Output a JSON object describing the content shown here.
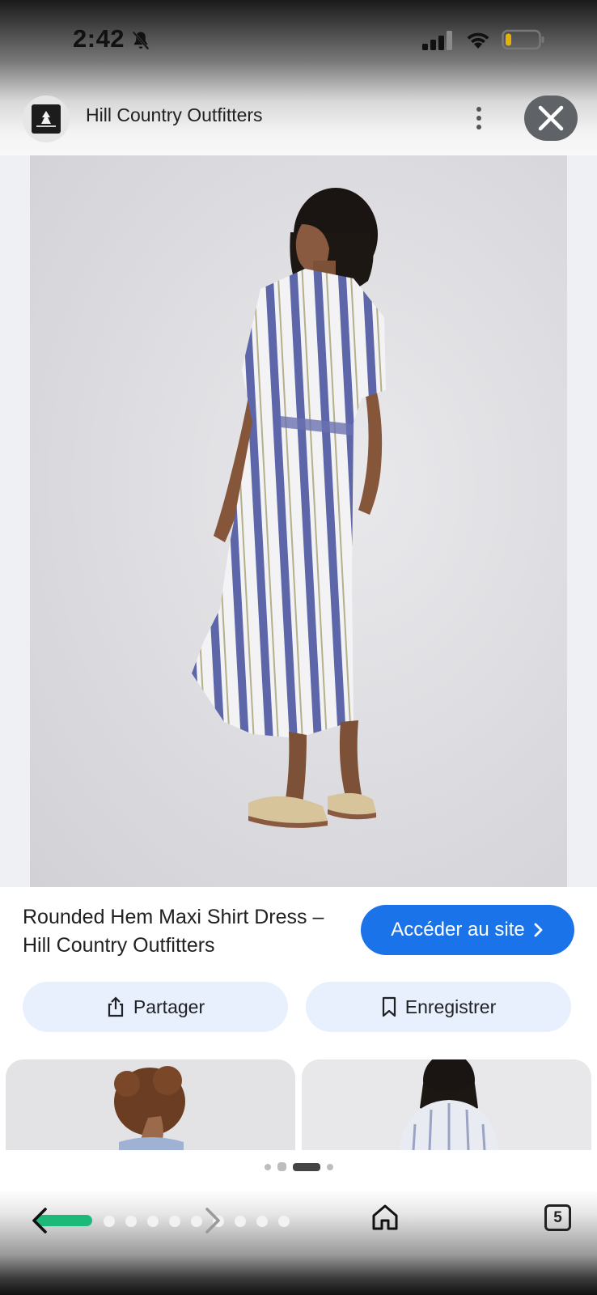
{
  "status_bar": {
    "time": "2:42",
    "icons": [
      "bell-off-icon",
      "signal-icon",
      "wifi-icon",
      "battery-icon"
    ]
  },
  "header": {
    "site_name": "Hill Country Outfitters",
    "menu_icon": "more-vert-icon",
    "close_icon": "close-icon"
  },
  "product": {
    "title": "Rounded Hem Maxi Shirt Dress – Hill Country Outfitters",
    "visit_label": "Accéder au site",
    "visit_icon": "chevron-right-icon"
  },
  "actions": {
    "share_label": "Partager",
    "share_icon": "share-icon",
    "save_label": "Enregistrer",
    "save_icon": "bookmark-icon"
  },
  "pager": {
    "count": 4,
    "active_index": 2
  },
  "bottom_nav": {
    "tabs_count": "5",
    "icons": [
      "back-icon",
      "forward-icon",
      "home-icon",
      "tabs-icon"
    ]
  },
  "colors": {
    "accent": "#1a73e8",
    "pill_bg": "#e8f0fe",
    "progress": "#1db97a",
    "close_bg": "#5f6368"
  }
}
